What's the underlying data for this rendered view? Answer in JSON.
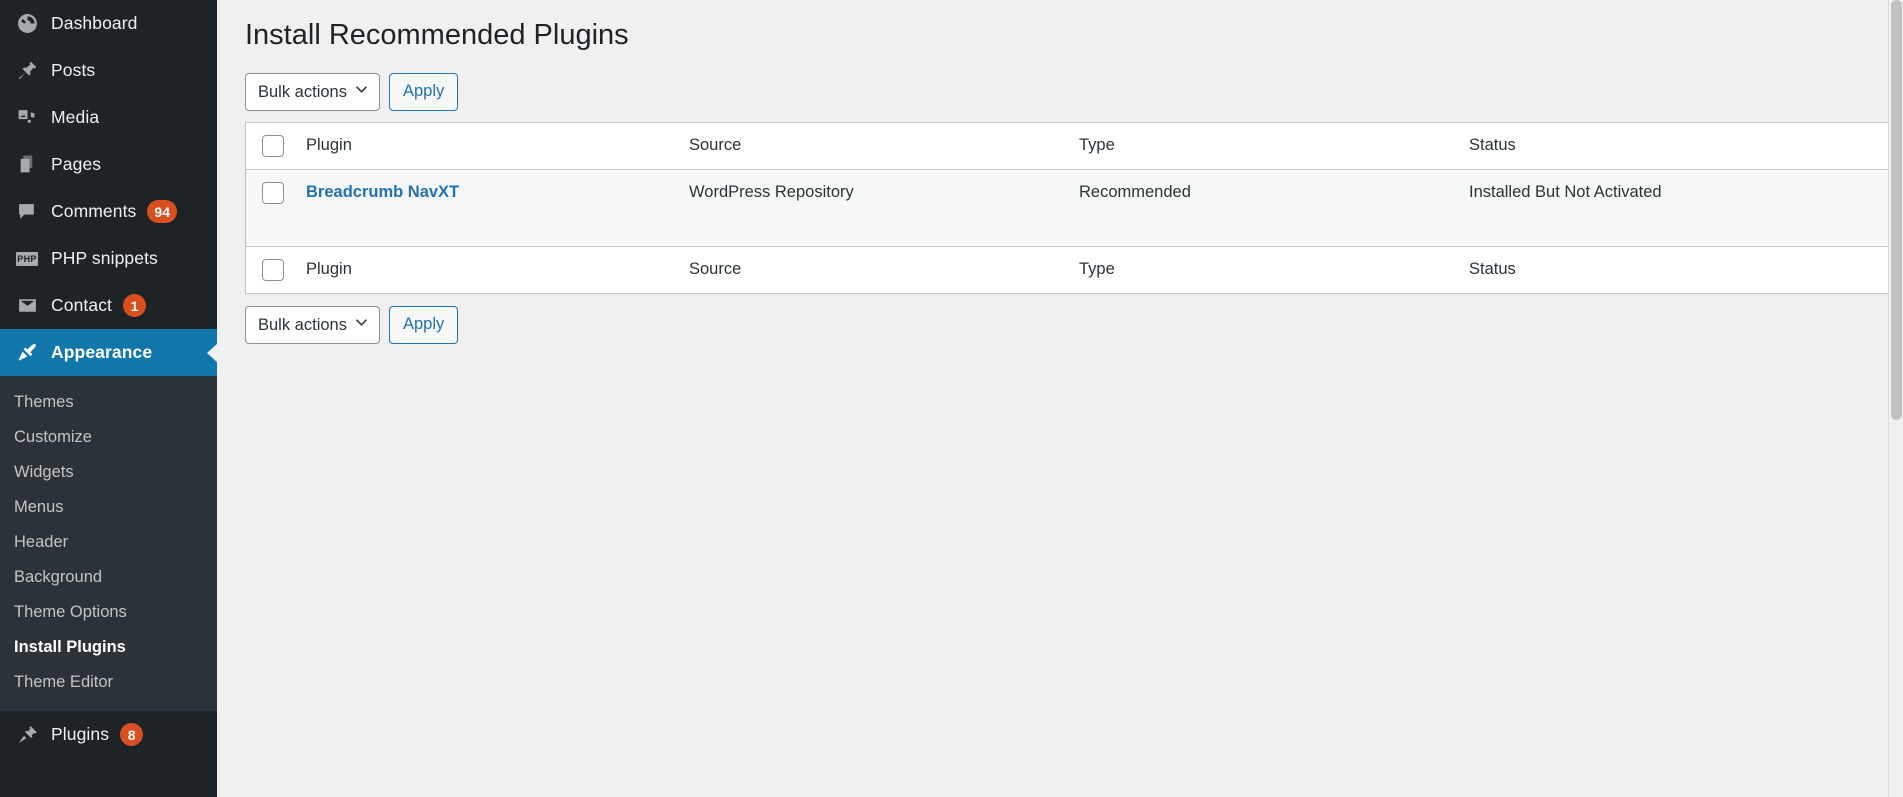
{
  "sidebar": {
    "items": [
      {
        "label": "Dashboard",
        "icon": "dashboard-icon",
        "badge": null,
        "current": false
      },
      {
        "label": "Posts",
        "icon": "pin-icon",
        "badge": null,
        "current": false
      },
      {
        "label": "Media",
        "icon": "media-icon",
        "badge": null,
        "current": false
      },
      {
        "label": "Pages",
        "icon": "pages-icon",
        "badge": null,
        "current": false
      },
      {
        "label": "Comments",
        "icon": "comment-icon",
        "badge": "94",
        "current": false
      },
      {
        "label": "PHP snippets",
        "icon": "php-icon",
        "badge": null,
        "current": false
      },
      {
        "label": "Contact",
        "icon": "email-icon",
        "badge": "1",
        "current": false
      },
      {
        "label": "Appearance",
        "icon": "brush-icon",
        "badge": null,
        "current": true
      },
      {
        "label": "Plugins",
        "icon": "plug-icon",
        "badge": "8",
        "current": false
      }
    ],
    "submenu": [
      {
        "label": "Themes",
        "current": false
      },
      {
        "label": "Customize",
        "current": false
      },
      {
        "label": "Widgets",
        "current": false
      },
      {
        "label": "Menus",
        "current": false
      },
      {
        "label": "Header",
        "current": false
      },
      {
        "label": "Background",
        "current": false
      },
      {
        "label": "Theme Options",
        "current": false
      },
      {
        "label": "Install Plugins",
        "current": true
      },
      {
        "label": "Theme Editor",
        "current": false
      }
    ]
  },
  "page": {
    "title": "Install Recommended Plugins"
  },
  "toolbar_top": {
    "bulk_label": "Bulk actions",
    "apply_label": "Apply"
  },
  "toolbar_bottom": {
    "bulk_label": "Bulk actions",
    "apply_label": "Apply"
  },
  "table": {
    "columns": {
      "plugin": "Plugin",
      "source": "Source",
      "type": "Type",
      "status": "Status"
    },
    "footer_columns": {
      "plugin": "Plugin",
      "source": "Source",
      "type": "Type",
      "status": "Status"
    },
    "rows": [
      {
        "plugin": "Breadcrumb NavXT",
        "source": "WordPress Repository",
        "type": "Recommended",
        "status": "Installed But Not Activated"
      }
    ]
  },
  "colors": {
    "sidebar_bg": "#1d2327",
    "submenu_bg": "#2c3338",
    "current_bg": "#1177ab",
    "link": "#2271b1",
    "badge": "#d94f20",
    "page_bg": "#f0f0f1"
  }
}
